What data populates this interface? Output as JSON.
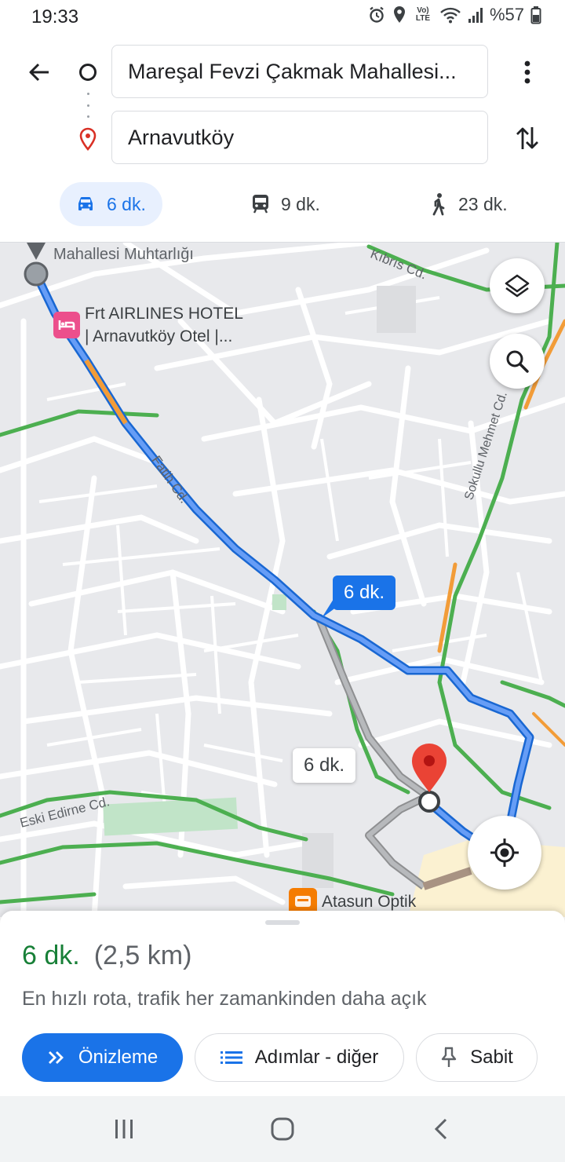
{
  "status_bar": {
    "time": "19:33",
    "network": "Vo) LTE",
    "battery": "%57",
    "icons": [
      "alarm-icon",
      "location-icon",
      "volte-icon",
      "wifi-icon",
      "signal-icon",
      "battery-icon"
    ]
  },
  "directions": {
    "origin": "Mareşal Fevzi Çakmak Mahallesi...",
    "destination": "Arnavutköy",
    "modes": [
      {
        "name": "car",
        "label": "6 dk.",
        "selected": true
      },
      {
        "name": "transit",
        "label": "9 dk.",
        "selected": false
      },
      {
        "name": "walk",
        "label": "23 dk.",
        "selected": false
      }
    ]
  },
  "map": {
    "labels": {
      "muhtarlik": "Mahallesi Muhtarlığı",
      "kibris": "Kıbrıs Cd.",
      "hotel_line1": "Frt AIRLINES HOTEL",
      "hotel_line2": "| Arnavutköy Otel |...",
      "fatih": "Fatih Cd.",
      "sokullu": "Sokullu Mehmet Cd.",
      "eski_edirne": "Eski Edirne Cd.",
      "optik": "Atasun Optik"
    },
    "route_primary_time": "6 dk.",
    "route_alt_time": "6 dk."
  },
  "summary": {
    "time": "6 dk.",
    "distance": "(2,5 km)",
    "note": "En hızlı rota, trafik her zamankinden daha açık"
  },
  "actions": {
    "preview": "Önizleme",
    "steps": "Adımlar - diğer",
    "pin": "Sabit"
  },
  "colors": {
    "accent": "#1a73e8",
    "route_primary": "#4a80e8",
    "route_alt": "#a7a9ac",
    "traffic_clear": "#4caf50",
    "traffic_slow": "#f29c38",
    "summary_time": "#188038"
  }
}
